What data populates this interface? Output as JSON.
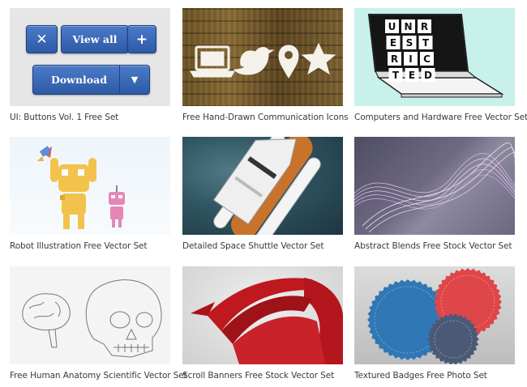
{
  "cards": [
    {
      "caption": "UI: Buttons Vol. 1 Free Set",
      "buttons": {
        "close": "✕",
        "view_all": "View all",
        "plus": "+",
        "download": "Download",
        "caret": "▼"
      }
    },
    {
      "caption": "Free Hand-Drawn Communication Icons"
    },
    {
      "caption": "Computers and Hardware Free Vector Set",
      "screen_letters": [
        "U",
        "N",
        "R",
        "E",
        "S",
        "T",
        "R",
        "I",
        "C",
        "T",
        "E",
        "D"
      ]
    },
    {
      "caption": "Robot Illustration Free Vector Set"
    },
    {
      "caption": "Detailed Space Shuttle Vector Set"
    },
    {
      "caption": "Abstract Blends Free Stock Vector Set"
    },
    {
      "caption": "Free Human Anatomy Scientific Vector Set"
    },
    {
      "caption": "Scroll Banners Free Stock Vector Set"
    },
    {
      "caption": "Textured Badges Free Photo Set"
    }
  ],
  "colors": {
    "button_blue": "#3566b3",
    "mint_bg": "#c9f1ec",
    "banner_red": "#c0181f",
    "badge_blue": "#2f78b5",
    "badge_red": "#df4649",
    "badge_navy": "#4a5a76"
  }
}
